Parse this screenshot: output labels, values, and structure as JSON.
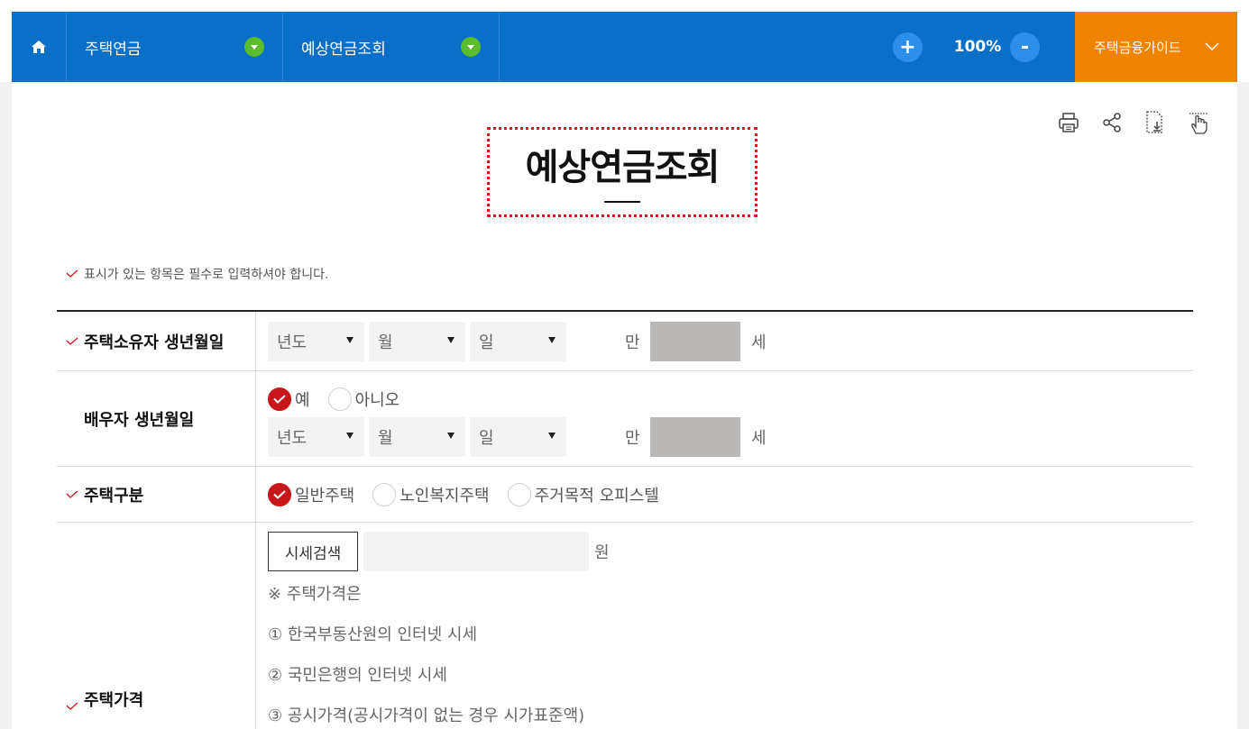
{
  "nav": {
    "home_icon": "home-icon",
    "menu1": "주택연금",
    "menu2": "예상연금조회",
    "zoom_in": "+",
    "zoom_level": "100%",
    "zoom_out": "-",
    "guide": "주택금융가이드"
  },
  "tools": [
    "print-icon",
    "share-icon",
    "download-icon",
    "touch-icon"
  ],
  "page": {
    "title": "예상연금조회",
    "notice": "표시가 있는 항목은 필수로 입력하셔야 합니다."
  },
  "form": {
    "owner_birth": {
      "label": "주택소유자 생년월일",
      "year": "년도",
      "month": "월",
      "day": "일",
      "age_prefix": "만",
      "age_suffix": "세"
    },
    "spouse_birth": {
      "label": "배우자 생년월일",
      "opt_yes": "예",
      "opt_no": "아니오",
      "year": "년도",
      "month": "월",
      "day": "일",
      "age_prefix": "만",
      "age_suffix": "세"
    },
    "house_type": {
      "label": "주택구분",
      "opt1": "일반주택",
      "opt2": "노인복지주택",
      "opt3": "주거목적 오피스텔"
    },
    "house_price": {
      "label": "주택가격",
      "search_btn": "시세검색",
      "unit": "원",
      "note_title": "※ 주택가격은",
      "note1": "① 한국부동산원의 인터넷 시세",
      "note2": "② 국민은행의 인터넷 시세",
      "note3": "③ 공시가격(공시가격이 없는 경우 시가표준액)"
    }
  },
  "colors": {
    "nav_blue": "#0a6fc7",
    "guide_orange": "#f08300",
    "check_red": "#c8161d",
    "dropdown_green": "#5bbc2e"
  }
}
